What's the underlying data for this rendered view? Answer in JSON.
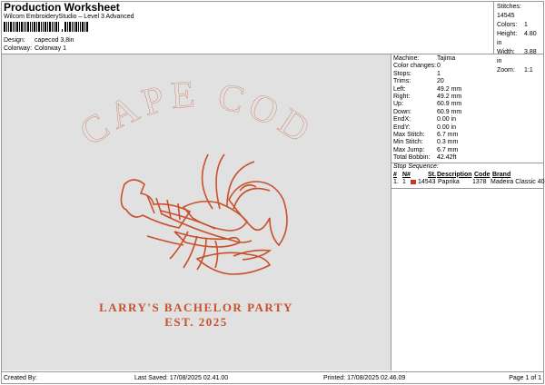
{
  "header": {
    "title": "Production Worksheet",
    "subtitle": "Wilcom EmbroideryStudio – Level 3 Advanced",
    "design_label": "Design:",
    "design_value": "capecod 3,8in",
    "colorway_label": "Colorway:",
    "colorway_value": "Colorway 1"
  },
  "stats": [
    {
      "label": "Stitches:",
      "value": "14545"
    },
    {
      "label": "Colors:",
      "value": "1"
    },
    {
      "label": "Height:",
      "value": "4.80 in"
    },
    {
      "label": "Width:",
      "value": "3.88 in"
    },
    {
      "label": "Zoom:",
      "value": "1:1"
    }
  ],
  "design": {
    "line1": "CAPE COD",
    "line2": "LARRY'S BACHELOR PARTY",
    "line3": "EST. 2025",
    "thread_color": "#c8502c",
    "background": "#e1e1e1"
  },
  "properties": [
    {
      "label": "Machine:",
      "value": "Tajima"
    },
    {
      "label": "Color changes:",
      "value": "0"
    },
    {
      "label": "Stops:",
      "value": "1"
    },
    {
      "label": "Trims:",
      "value": "20"
    },
    {
      "label": "Left:",
      "value": "49.2 mm"
    },
    {
      "label": "Right:",
      "value": "49.2 mm"
    },
    {
      "label": "Up:",
      "value": "60.9 mm"
    },
    {
      "label": "Down:",
      "value": "60.9 mm"
    },
    {
      "label": "EndX:",
      "value": "0.00 in"
    },
    {
      "label": "EndY:",
      "value": "0.00 in"
    },
    {
      "label": "Max Stitch:",
      "value": "6.7 mm"
    },
    {
      "label": "Min Stitch:",
      "value": "0.3 mm"
    },
    {
      "label": "Max Jump:",
      "value": "6.7 mm"
    },
    {
      "label": "Total Bobbin:",
      "value": "42.42ft"
    }
  ],
  "stop_sequence": {
    "title": "Stop Sequence:",
    "columns": [
      "#",
      "N#",
      "St.",
      "Description",
      "Code",
      "Brand"
    ],
    "rows": [
      {
        "num": "1.",
        "n": "1",
        "st": "14543",
        "description": "Paprika",
        "code": "1378",
        "brand": "Madeira Classic 40",
        "color": "#c0392b"
      }
    ]
  },
  "footer": {
    "created_by": "Created By:",
    "last_saved": "Last Saved: 17/08/2025 02.41.00",
    "printed": "Printed: 17/08/2025 02.46.09",
    "page": "Page 1 of 1"
  }
}
